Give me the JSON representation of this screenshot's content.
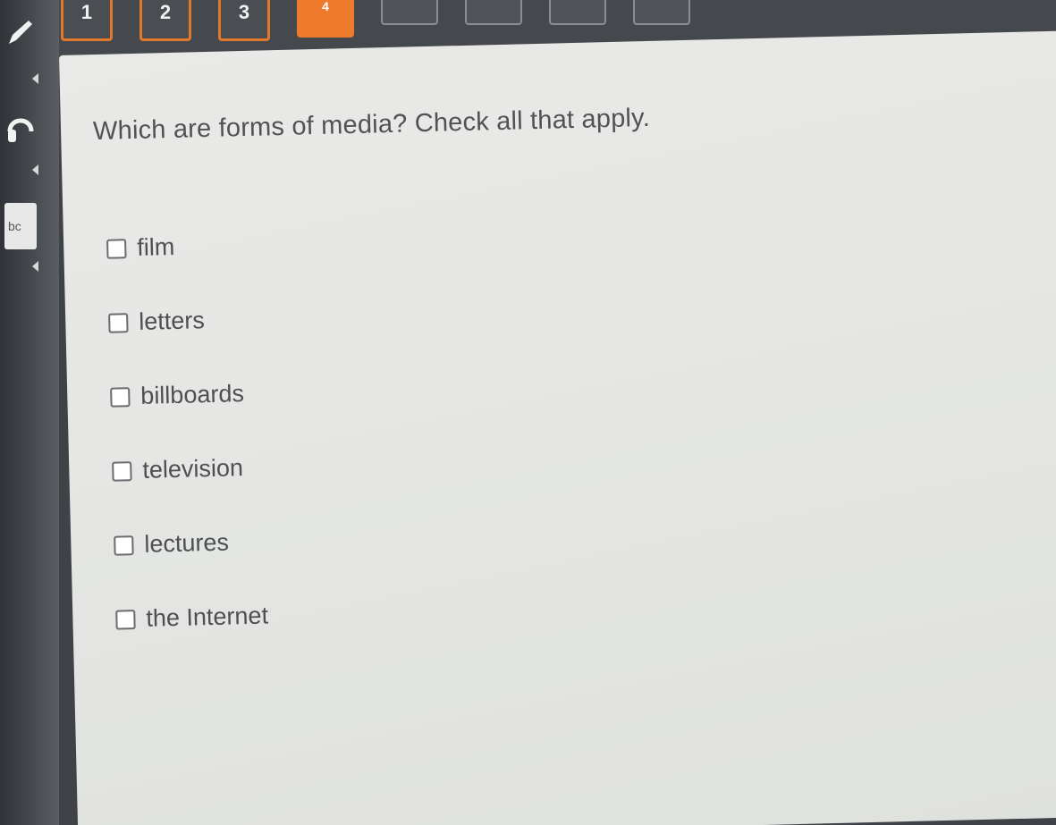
{
  "nav": {
    "questions": [
      {
        "label": "1",
        "state": "done"
      },
      {
        "label": "2",
        "state": "done"
      },
      {
        "label": "3",
        "state": "done"
      },
      {
        "label": "4",
        "state": "current"
      },
      {
        "label": "",
        "state": "empty"
      },
      {
        "label": "",
        "state": "empty"
      },
      {
        "label": "",
        "state": "empty"
      },
      {
        "label": "",
        "state": "empty"
      }
    ]
  },
  "tools": {
    "pencil_icon": "pencil-icon",
    "audio_icon": "headphones-icon",
    "reference_label": "bc"
  },
  "question": {
    "prompt": "Which are forms of media? Check all that apply."
  },
  "options": [
    {
      "label": "film",
      "checked": false
    },
    {
      "label": "letters",
      "checked": false
    },
    {
      "label": "billboards",
      "checked": false
    },
    {
      "label": "television",
      "checked": false
    },
    {
      "label": "lectures",
      "checked": false
    },
    {
      "label": "the Internet",
      "checked": false
    }
  ],
  "colors": {
    "accent": "#ee7a2b",
    "rail": "#3f4247",
    "panel": "#e7e8e6",
    "text": "#4d4f52"
  }
}
